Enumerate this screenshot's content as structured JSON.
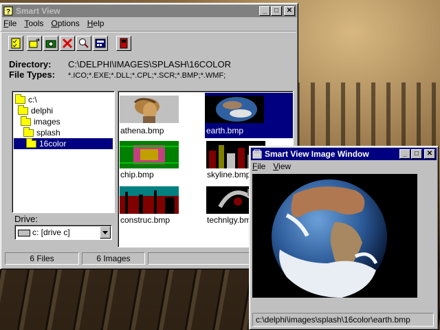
{
  "main_window": {
    "title": "Smart View",
    "menu": [
      "File",
      "Tools",
      "Options",
      "Help"
    ],
    "directory_label": "Directory:",
    "directory_value": "C:\\DELPHI\\IMAGES\\SPLASH\\16COLOR",
    "filetypes_label": "File Types:",
    "filetypes_value": "*.ICO;*.EXE;*.DLL;*.CPL;*.SCR;*.BMP;*.WMF;",
    "tree": [
      "c:\\",
      "delphi",
      "images",
      "splash",
      "16color"
    ],
    "drive_label": "Drive:",
    "drive_value": "c: [drive c]",
    "thumbnails": [
      {
        "name": "athena.bmp",
        "selected": false
      },
      {
        "name": "earth.bmp",
        "selected": true
      },
      {
        "name": "chip.bmp",
        "selected": false
      },
      {
        "name": "skyline.bmp",
        "selected": false
      },
      {
        "name": "construc.bmp",
        "selected": false
      },
      {
        "name": "technlgy.bmp",
        "selected": false
      }
    ],
    "status_files": "6 Files",
    "status_images": "6 Images"
  },
  "image_window": {
    "title": "Smart View Image Window",
    "menu": [
      "File",
      "View"
    ],
    "path": "c:\\delphi\\images\\splash\\16color\\earth.bmp"
  },
  "toolbar_icons": [
    "checklist-icon",
    "folder-arrow-icon",
    "camera-icon",
    "delete-icon",
    "zoom-icon",
    "calculator-icon",
    "exit-icon"
  ],
  "colors": {
    "title_active": "#000080",
    "title_inactive": "#808080",
    "face": "#c0c0c0",
    "selection": "#000080"
  }
}
